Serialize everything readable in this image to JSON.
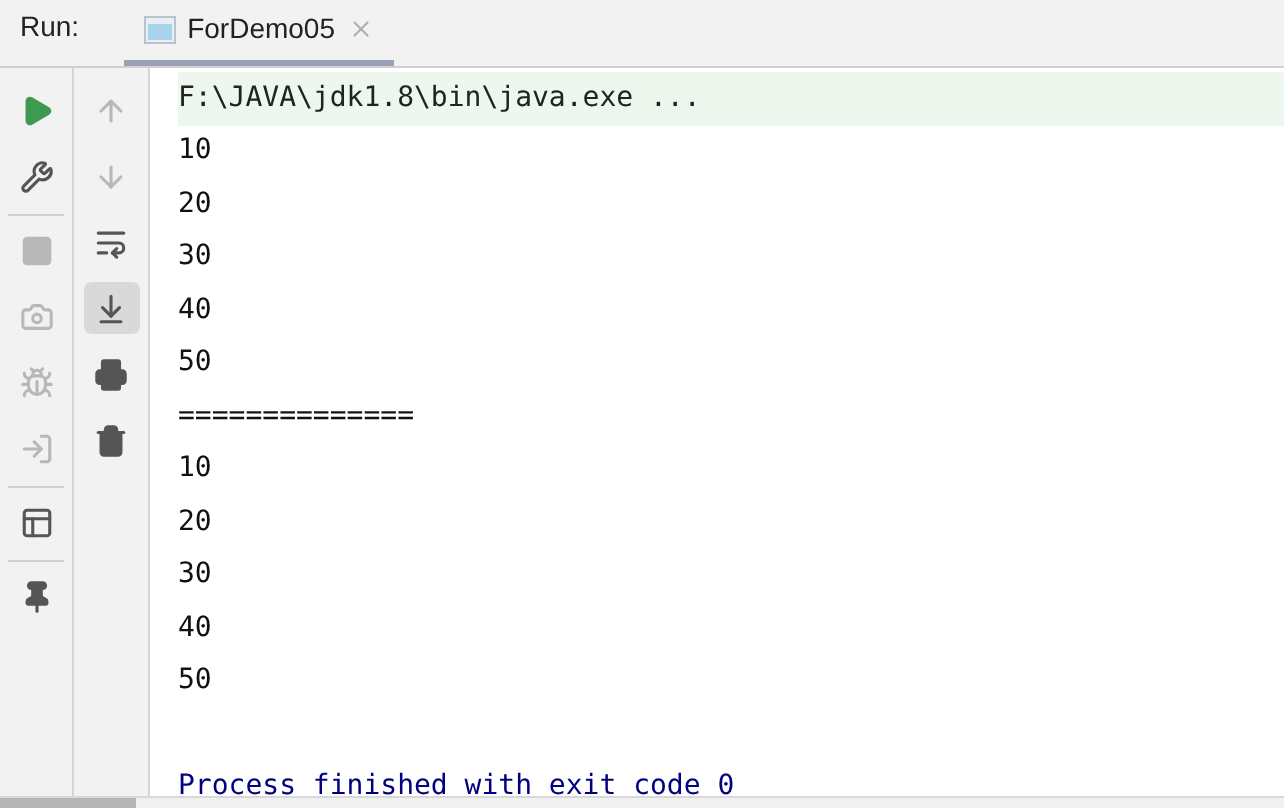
{
  "run_bar": {
    "label": "Run:",
    "tabs": [
      {
        "title": "ForDemo05",
        "selected": true
      }
    ]
  },
  "left_toolbar": {
    "groups": [
      {
        "tools": [
          {
            "kind": "run",
            "disabled": false
          },
          {
            "kind": "wrench",
            "disabled": false
          }
        ]
      },
      {
        "tools": [
          {
            "kind": "stop",
            "disabled": true
          },
          {
            "kind": "camera",
            "disabled": true
          },
          {
            "kind": "bug",
            "disabled": true
          },
          {
            "kind": "enter",
            "disabled": true
          }
        ]
      },
      {
        "tools": [
          {
            "kind": "layout",
            "disabled": false
          }
        ]
      },
      {
        "tools": [
          {
            "kind": "pin",
            "disabled": false
          }
        ]
      }
    ]
  },
  "console_toolbar": {
    "tools": [
      {
        "kind": "up",
        "disabled": true,
        "selected": false
      },
      {
        "kind": "down",
        "disabled": true,
        "selected": false
      },
      {
        "kind": "wrap",
        "disabled": false,
        "selected": false
      },
      {
        "kind": "scroll-end",
        "disabled": false,
        "selected": true
      },
      {
        "kind": "print",
        "disabled": false,
        "selected": false
      },
      {
        "kind": "trash",
        "disabled": false,
        "selected": false
      }
    ]
  },
  "console": {
    "lines": [
      {
        "kind": "command",
        "text": "F:\\JAVA\\jdk1.8\\bin\\java.exe ..."
      },
      {
        "kind": "output",
        "text": "10"
      },
      {
        "kind": "output",
        "text": "20"
      },
      {
        "kind": "output",
        "text": "30"
      },
      {
        "kind": "output",
        "text": "40"
      },
      {
        "kind": "output",
        "text": "50"
      },
      {
        "kind": "output",
        "text": "=============="
      },
      {
        "kind": "output",
        "text": "10"
      },
      {
        "kind": "output",
        "text": "20"
      },
      {
        "kind": "output",
        "text": "30"
      },
      {
        "kind": "output",
        "text": "40"
      },
      {
        "kind": "output",
        "text": "50"
      },
      {
        "kind": "exit",
        "text": "Process finished with exit code 0"
      }
    ]
  }
}
